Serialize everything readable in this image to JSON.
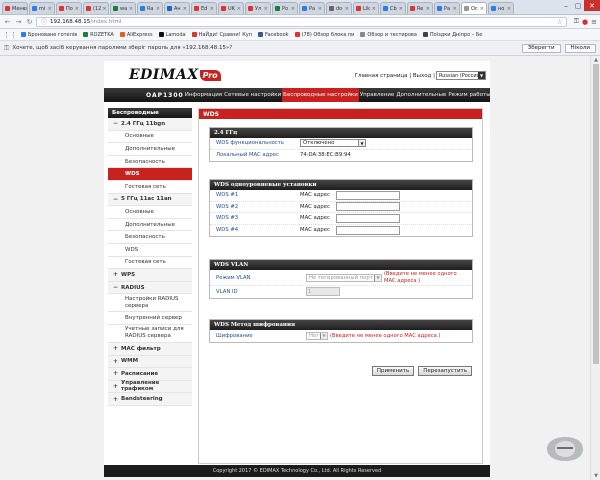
{
  "browser": {
    "tabs": [
      {
        "label": "Меню",
        "color": "#d33"
      },
      {
        "label": "mi",
        "color": "#2b7de9"
      },
      {
        "label": "По",
        "color": "#d33"
      },
      {
        "label": "(12",
        "color": "#d33"
      },
      {
        "label": "wa",
        "color": "#1a7f3c"
      },
      {
        "label": "Ra",
        "color": "#2b7de9"
      },
      {
        "label": "Ан",
        "color": "#1a66c8"
      },
      {
        "label": "Ed",
        "color": "#d33"
      },
      {
        "label": "UK",
        "color": "#d33"
      },
      {
        "label": "Ул",
        "color": "#d33"
      },
      {
        "label": "Ро",
        "color": "#1a7f3c"
      },
      {
        "label": "Ра",
        "color": "#2b7de9"
      },
      {
        "label": "do",
        "color": "#666"
      },
      {
        "label": "Lik",
        "color": "#d33"
      },
      {
        "label": "Cb",
        "color": "#2b7de9"
      },
      {
        "label": "Re",
        "color": "#d33"
      },
      {
        "label": "Ра",
        "color": "#2b7de9"
      },
      {
        "label": "Ос",
        "color": "#999"
      },
      {
        "label": "но",
        "color": "#2b7de9"
      }
    ],
    "url_host": "192.168.48.15",
    "url_path": "/index.html",
    "bookmarks": [
      {
        "label": "Броноване готелів",
        "color": "#2b7de9"
      },
      {
        "label": "ROZETKA",
        "color": "#1a7f3c"
      },
      {
        "label": "AliExpress",
        "color": "#e85f1a"
      },
      {
        "label": "Lamoda",
        "color": "#111"
      },
      {
        "label": "НаЙди! Сравни! Куп",
        "color": "#d33"
      },
      {
        "label": "Facebook",
        "color": "#3b5998"
      },
      {
        "label": "(78) Обзор блока пи",
        "color": "#d33"
      },
      {
        "label": "Обзор и тестирова",
        "color": "#888"
      },
      {
        "label": "Поїздки Дніпро – Бе",
        "color": "#444"
      }
    ],
    "password_prompt": "Хочете, щоб засіб керування паролями зберіг пароль для «192.168.48.15»?",
    "save_button": "Зберегти",
    "never_button": "Ніколи"
  },
  "router": {
    "logo_text": "EDIMAX",
    "logo_pro": "Pro",
    "top_links": "Главная страница | Выход |",
    "language": "Russian (Россия)",
    "model": "OAP1300",
    "menu": [
      {
        "label": "Информация",
        "active": false
      },
      {
        "label": "Сетевые настройки",
        "active": false
      },
      {
        "label": "Беспроводные настройки",
        "active": true
      },
      {
        "label": "Управление",
        "active": false
      },
      {
        "label": "Дополнительные",
        "active": false
      },
      {
        "label": "Режим работы",
        "active": false
      }
    ],
    "sidebar_title": "Беспроводные",
    "sidebar": [
      {
        "label": "2.4 ГГц 11bgn",
        "type": "group",
        "prefix": "−"
      },
      {
        "label": "Основные",
        "type": "sub"
      },
      {
        "label": "Дополнительные",
        "type": "sub"
      },
      {
        "label": "Безопасность",
        "type": "sub"
      },
      {
        "label": "WDS",
        "type": "sub",
        "active": true
      },
      {
        "label": "Гостевая сеть",
        "type": "sub"
      },
      {
        "label": "5 ГГц 11ac 11an",
        "type": "group",
        "prefix": "−"
      },
      {
        "label": "Основные",
        "type": "sub"
      },
      {
        "label": "Дополнительные",
        "type": "sub"
      },
      {
        "label": "Безопасность",
        "type": "sub"
      },
      {
        "label": "WDS",
        "type": "sub"
      },
      {
        "label": "Гостевая сеть",
        "type": "sub"
      },
      {
        "label": "WPS",
        "type": "group",
        "prefix": "+"
      },
      {
        "label": "RADIUS",
        "type": "group",
        "prefix": "−"
      },
      {
        "label": "Настройки RADIUS сервера",
        "type": "sub",
        "tall": true
      },
      {
        "label": "Внутренний сервер",
        "type": "sub"
      },
      {
        "label": "Учетные записи для RADIUS сервера",
        "type": "sub",
        "tall": true
      },
      {
        "label": "MAC фильтр",
        "type": "group",
        "prefix": "+"
      },
      {
        "label": "WMM",
        "type": "group",
        "prefix": "+"
      },
      {
        "label": "Расписание",
        "type": "group",
        "prefix": "+"
      },
      {
        "label": "Управление трафиком",
        "type": "group",
        "prefix": "+"
      },
      {
        "label": "Bandsteering",
        "type": "group",
        "prefix": "+"
      }
    ],
    "content_title": "WDS",
    "band_panel": {
      "title": "2.4 ГГц",
      "wds_func_label": "WDS функциональность",
      "wds_func_value": "Отключено",
      "mac_label": "Локальный MAC адрес",
      "mac_value": "74:DA:38:EC:B9:94"
    },
    "peers_panel": {
      "title": "WDS одноуровневые установки",
      "mac_word": "MAC адрес",
      "rows": [
        "WDS #1",
        "WDS #2",
        "WDS #3",
        "WDS #4"
      ]
    },
    "vlan_panel": {
      "title": "WDS VLAN",
      "mode_label": "Режим VLAN",
      "mode_value": "Не тегированный порт",
      "note": "(Введите не менее одного MAC адреса.)",
      "id_label": "VLAN ID",
      "id_value": "1"
    },
    "enc_panel": {
      "title": "WDS Метод шифрования",
      "label": "Шифрование",
      "value": "Нет",
      "note": "(Введите не менее одного MAC адреса.)"
    },
    "apply_button": "Применить",
    "restart_button": "Перезапустить",
    "footer": "Copyright 2017 © EDIMAX Technology Co., Ltd. All Rights Reserved"
  }
}
